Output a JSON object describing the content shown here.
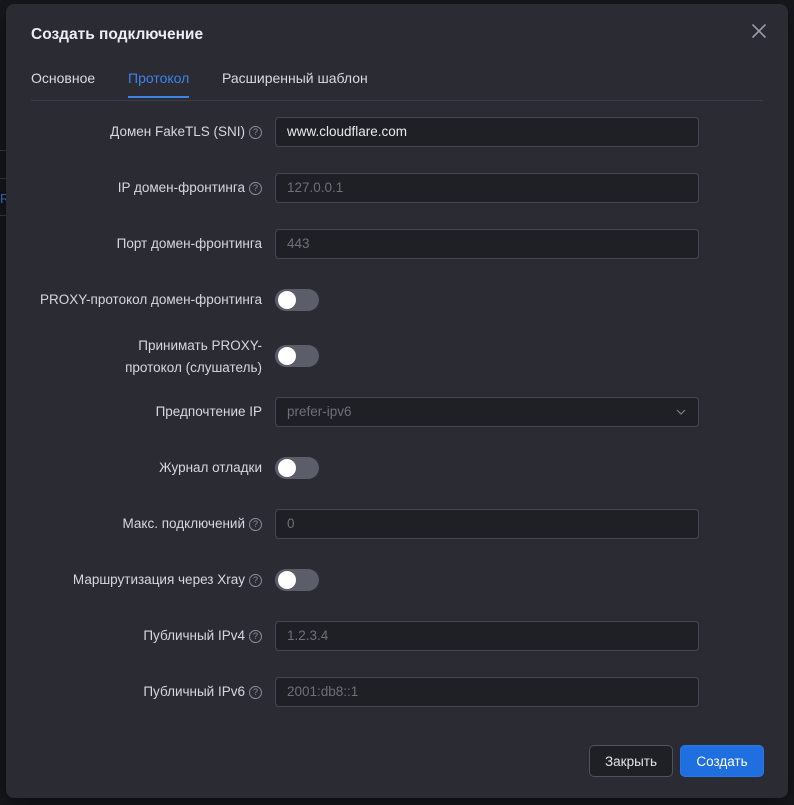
{
  "dialog": {
    "title": "Создать подключение",
    "close_icon": "close-icon"
  },
  "tabs": [
    {
      "label": "Основное",
      "active": false
    },
    {
      "label": "Протокол",
      "active": true
    },
    {
      "label": "Расширенный шаблон",
      "active": false
    }
  ],
  "fields": {
    "fake_tls_domain": {
      "label": "Домен FakeTLS (SNI)",
      "value": "www.cloudflare.com",
      "has_help": true
    },
    "fronting_ip": {
      "label": "IP домен-фронтинга",
      "placeholder": "127.0.0.1",
      "has_help": true
    },
    "fronting_port": {
      "label": "Порт домен-фронтинга",
      "placeholder": "443"
    },
    "fronting_proxy_protocol": {
      "label": "PROXY-протокол домен-фронтинга",
      "enabled": false
    },
    "accept_proxy": {
      "label": "Принимать PROXY-протокол (слушатель)",
      "enabled": false
    },
    "ip_preference": {
      "label": "Предпочтение IP",
      "placeholder": "prefer-ipv6"
    },
    "debug_log": {
      "label": "Журнал отладки",
      "enabled": false
    },
    "max_connections": {
      "label": "Макс. подключений",
      "placeholder": "0",
      "has_help": true
    },
    "xray_routing": {
      "label": "Маршрутизация через Xray",
      "enabled": false,
      "has_help": true
    },
    "public_ipv4": {
      "label": "Публичный IPv4",
      "placeholder": "1.2.3.4",
      "has_help": true
    },
    "public_ipv6": {
      "label": "Публичный IPv6",
      "placeholder": "2001:db8::1",
      "has_help": true
    }
  },
  "footer": {
    "close_label": "Закрыть",
    "create_label": "Создать"
  },
  "help_glyph": "?",
  "background": {
    "fragment_letter": "R"
  },
  "colors": {
    "accent": "#3d82e8",
    "primary_button": "#1f6fe0",
    "dialog_bg": "#2a2b33",
    "input_bg": "#1f2026"
  }
}
